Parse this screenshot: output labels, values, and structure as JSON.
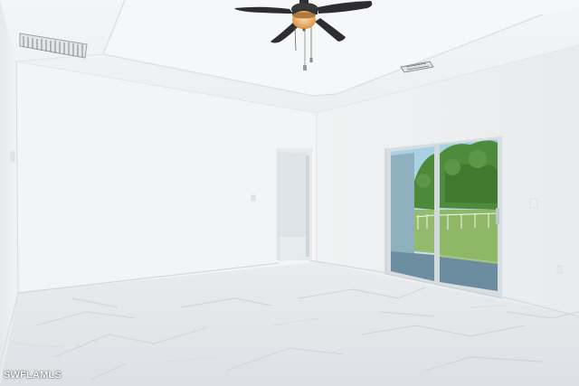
{
  "watermark": {
    "text": "SWFLAMLS"
  },
  "colors": {
    "wall": "#eef0f1",
    "ceiling": "#f3f4f5",
    "floor": "#e4e7ea",
    "floor_vein": "#c9ced4",
    "fan_blade": "#2f2f31",
    "fan_light": "#f0b46a",
    "glass_sky": "#a9d3e6",
    "foliage": "#4f8b3c",
    "lawn": "#8fb866",
    "door_frame": "#dfe3e6"
  },
  "icons": [
    "ceiling-fan-icon"
  ]
}
